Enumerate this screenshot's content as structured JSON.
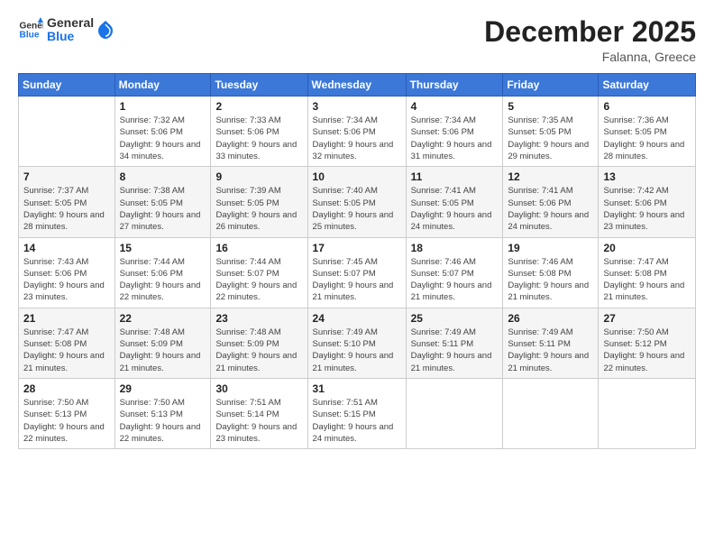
{
  "header": {
    "logo_general": "General",
    "logo_blue": "Blue",
    "month": "December 2025",
    "location": "Falanna, Greece"
  },
  "weekdays": [
    "Sunday",
    "Monday",
    "Tuesday",
    "Wednesday",
    "Thursday",
    "Friday",
    "Saturday"
  ],
  "weeks": [
    [
      {
        "day": "",
        "sunrise": "",
        "sunset": "",
        "daylight": ""
      },
      {
        "day": "1",
        "sunrise": "Sunrise: 7:32 AM",
        "sunset": "Sunset: 5:06 PM",
        "daylight": "Daylight: 9 hours and 34 minutes."
      },
      {
        "day": "2",
        "sunrise": "Sunrise: 7:33 AM",
        "sunset": "Sunset: 5:06 PM",
        "daylight": "Daylight: 9 hours and 33 minutes."
      },
      {
        "day": "3",
        "sunrise": "Sunrise: 7:34 AM",
        "sunset": "Sunset: 5:06 PM",
        "daylight": "Daylight: 9 hours and 32 minutes."
      },
      {
        "day": "4",
        "sunrise": "Sunrise: 7:34 AM",
        "sunset": "Sunset: 5:06 PM",
        "daylight": "Daylight: 9 hours and 31 minutes."
      },
      {
        "day": "5",
        "sunrise": "Sunrise: 7:35 AM",
        "sunset": "Sunset: 5:05 PM",
        "daylight": "Daylight: 9 hours and 29 minutes."
      },
      {
        "day": "6",
        "sunrise": "Sunrise: 7:36 AM",
        "sunset": "Sunset: 5:05 PM",
        "daylight": "Daylight: 9 hours and 28 minutes."
      }
    ],
    [
      {
        "day": "7",
        "sunrise": "Sunrise: 7:37 AM",
        "sunset": "Sunset: 5:05 PM",
        "daylight": "Daylight: 9 hours and 28 minutes."
      },
      {
        "day": "8",
        "sunrise": "Sunrise: 7:38 AM",
        "sunset": "Sunset: 5:05 PM",
        "daylight": "Daylight: 9 hours and 27 minutes."
      },
      {
        "day": "9",
        "sunrise": "Sunrise: 7:39 AM",
        "sunset": "Sunset: 5:05 PM",
        "daylight": "Daylight: 9 hours and 26 minutes."
      },
      {
        "day": "10",
        "sunrise": "Sunrise: 7:40 AM",
        "sunset": "Sunset: 5:05 PM",
        "daylight": "Daylight: 9 hours and 25 minutes."
      },
      {
        "day": "11",
        "sunrise": "Sunrise: 7:41 AM",
        "sunset": "Sunset: 5:05 PM",
        "daylight": "Daylight: 9 hours and 24 minutes."
      },
      {
        "day": "12",
        "sunrise": "Sunrise: 7:41 AM",
        "sunset": "Sunset: 5:06 PM",
        "daylight": "Daylight: 9 hours and 24 minutes."
      },
      {
        "day": "13",
        "sunrise": "Sunrise: 7:42 AM",
        "sunset": "Sunset: 5:06 PM",
        "daylight": "Daylight: 9 hours and 23 minutes."
      }
    ],
    [
      {
        "day": "14",
        "sunrise": "Sunrise: 7:43 AM",
        "sunset": "Sunset: 5:06 PM",
        "daylight": "Daylight: 9 hours and 23 minutes."
      },
      {
        "day": "15",
        "sunrise": "Sunrise: 7:44 AM",
        "sunset": "Sunset: 5:06 PM",
        "daylight": "Daylight: 9 hours and 22 minutes."
      },
      {
        "day": "16",
        "sunrise": "Sunrise: 7:44 AM",
        "sunset": "Sunset: 5:07 PM",
        "daylight": "Daylight: 9 hours and 22 minutes."
      },
      {
        "day": "17",
        "sunrise": "Sunrise: 7:45 AM",
        "sunset": "Sunset: 5:07 PM",
        "daylight": "Daylight: 9 hours and 21 minutes."
      },
      {
        "day": "18",
        "sunrise": "Sunrise: 7:46 AM",
        "sunset": "Sunset: 5:07 PM",
        "daylight": "Daylight: 9 hours and 21 minutes."
      },
      {
        "day": "19",
        "sunrise": "Sunrise: 7:46 AM",
        "sunset": "Sunset: 5:08 PM",
        "daylight": "Daylight: 9 hours and 21 minutes."
      },
      {
        "day": "20",
        "sunrise": "Sunrise: 7:47 AM",
        "sunset": "Sunset: 5:08 PM",
        "daylight": "Daylight: 9 hours and 21 minutes."
      }
    ],
    [
      {
        "day": "21",
        "sunrise": "Sunrise: 7:47 AM",
        "sunset": "Sunset: 5:08 PM",
        "daylight": "Daylight: 9 hours and 21 minutes."
      },
      {
        "day": "22",
        "sunrise": "Sunrise: 7:48 AM",
        "sunset": "Sunset: 5:09 PM",
        "daylight": "Daylight: 9 hours and 21 minutes."
      },
      {
        "day": "23",
        "sunrise": "Sunrise: 7:48 AM",
        "sunset": "Sunset: 5:09 PM",
        "daylight": "Daylight: 9 hours and 21 minutes."
      },
      {
        "day": "24",
        "sunrise": "Sunrise: 7:49 AM",
        "sunset": "Sunset: 5:10 PM",
        "daylight": "Daylight: 9 hours and 21 minutes."
      },
      {
        "day": "25",
        "sunrise": "Sunrise: 7:49 AM",
        "sunset": "Sunset: 5:11 PM",
        "daylight": "Daylight: 9 hours and 21 minutes."
      },
      {
        "day": "26",
        "sunrise": "Sunrise: 7:49 AM",
        "sunset": "Sunset: 5:11 PM",
        "daylight": "Daylight: 9 hours and 21 minutes."
      },
      {
        "day": "27",
        "sunrise": "Sunrise: 7:50 AM",
        "sunset": "Sunset: 5:12 PM",
        "daylight": "Daylight: 9 hours and 22 minutes."
      }
    ],
    [
      {
        "day": "28",
        "sunrise": "Sunrise: 7:50 AM",
        "sunset": "Sunset: 5:13 PM",
        "daylight": "Daylight: 9 hours and 22 minutes."
      },
      {
        "day": "29",
        "sunrise": "Sunrise: 7:50 AM",
        "sunset": "Sunset: 5:13 PM",
        "daylight": "Daylight: 9 hours and 22 minutes."
      },
      {
        "day": "30",
        "sunrise": "Sunrise: 7:51 AM",
        "sunset": "Sunset: 5:14 PM",
        "daylight": "Daylight: 9 hours and 23 minutes."
      },
      {
        "day": "31",
        "sunrise": "Sunrise: 7:51 AM",
        "sunset": "Sunset: 5:15 PM",
        "daylight": "Daylight: 9 hours and 24 minutes."
      },
      {
        "day": "",
        "sunrise": "",
        "sunset": "",
        "daylight": ""
      },
      {
        "day": "",
        "sunrise": "",
        "sunset": "",
        "daylight": ""
      },
      {
        "day": "",
        "sunrise": "",
        "sunset": "",
        "daylight": ""
      }
    ]
  ]
}
